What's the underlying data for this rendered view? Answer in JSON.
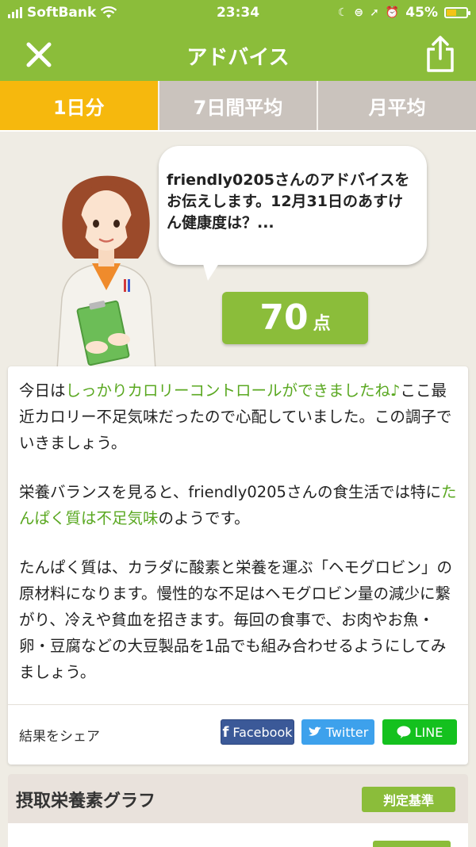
{
  "status_bar": {
    "carrier": "SoftBank",
    "time": "23:34",
    "battery": "45%",
    "battery_level": 0.45
  },
  "header": {
    "title": "アドバイス"
  },
  "tabs": [
    {
      "label": "1日分",
      "active": true
    },
    {
      "label": "7日間平均",
      "active": false
    },
    {
      "label": "月平均",
      "active": false
    }
  ],
  "advisor": {
    "bubble_text": "friendly0205さんのアドバイスをお伝えします。12月31日のあすけん健康度は？...",
    "score": "70",
    "score_unit": "点"
  },
  "advice": {
    "p1": [
      {
        "text": "今日は",
        "hl": false
      },
      {
        "text": "しっかりカロリーコントロールができましたね♪",
        "hl": true
      },
      {
        "text": "ここ最近カロリー不足気味だったので心配していました。この調子でいきましょう。",
        "hl": false
      }
    ],
    "p2": [
      {
        "text": "栄養バランスを見ると、friendly0205さんの食生活では特に",
        "hl": false
      },
      {
        "text": "たんぱく質は不足気味",
        "hl": true
      },
      {
        "text": "のようです。",
        "hl": false
      }
    ],
    "p3": "たんぱく質は、カラダに酸素と栄養を運ぶ「ヘモグロビン」の原材料になります。慢性的な不足はヘモグロビン量の減少に繋がり、冷えや貧血を招きます。毎回の食事で、お肉やお魚・卵・豆腐などの大豆製品を1品でも組み合わせるようにしてみましょう。"
  },
  "share": {
    "label": "結果をシェア",
    "facebook": "Facebook",
    "twitter": "Twitter",
    "line": "LINE"
  },
  "graph": {
    "title": "摂取栄養素グラフ",
    "criteria_button": "判定基準"
  },
  "colors": {
    "brand_green": "#8bbd3a",
    "active_tab": "#f6b80d",
    "highlight_green": "#5aa821"
  }
}
